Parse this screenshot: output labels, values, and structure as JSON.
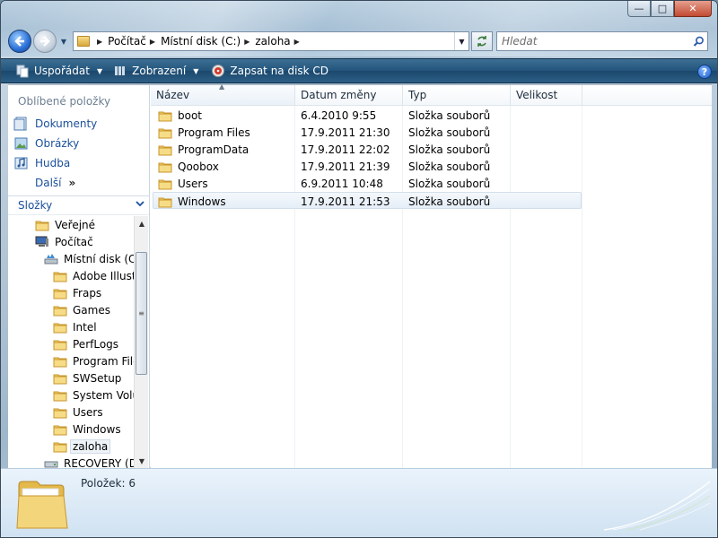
{
  "window": {
    "controls": {
      "minimize": "—",
      "maximize": "□",
      "close": "✕"
    }
  },
  "nav": {
    "back_icon": "back-arrow-icon",
    "forward_icon": "forward-arrow-icon",
    "breadcrumb": [
      "Počítač",
      "Místní disk (C:)",
      "zaloha"
    ],
    "search_placeholder": "Hledat"
  },
  "commandbar": {
    "organize": "Uspořádat",
    "views": "Zobrazení",
    "burn": "Zapsat na disk CD",
    "help": "?"
  },
  "sidebar": {
    "favorites_title": "Oblíbené položky",
    "favorites": [
      {
        "label": "Dokumenty",
        "icon": "documents-icon"
      },
      {
        "label": "Obrázky",
        "icon": "pictures-icon"
      },
      {
        "label": "Hudba",
        "icon": "music-icon"
      },
      {
        "label": "Další",
        "icon": "more-chevron-icon"
      }
    ],
    "folders_title": "Složky",
    "tree": [
      {
        "label": "Veřejné",
        "icon": "folder-icon"
      },
      {
        "label": "Počítač",
        "icon": "computer-icon"
      },
      {
        "label": "Místní disk (C:)",
        "icon": "drive-icon"
      },
      {
        "label": "Adobe Illustr",
        "icon": "folder-icon"
      },
      {
        "label": "Fraps",
        "icon": "folder-icon"
      },
      {
        "label": "Games",
        "icon": "folder-icon"
      },
      {
        "label": "Intel",
        "icon": "folder-icon"
      },
      {
        "label": "PerfLogs",
        "icon": "folder-icon"
      },
      {
        "label": "Program File",
        "icon": "folder-icon"
      },
      {
        "label": "SWSetup",
        "icon": "folder-icon"
      },
      {
        "label": "System Volu",
        "icon": "folder-icon"
      },
      {
        "label": "Users",
        "icon": "folder-icon"
      },
      {
        "label": "Windows",
        "icon": "folder-icon"
      },
      {
        "label": "zaloha",
        "icon": "folder-icon"
      },
      {
        "label": "RECOVERY (D:)",
        "icon": "drive-icon"
      }
    ]
  },
  "filelist": {
    "columns": [
      "Název",
      "Datum změny",
      "Typ",
      "Velikost"
    ],
    "rows": [
      {
        "name": "boot",
        "date": "6.4.2010 9:55",
        "type": "Složka souborů",
        "size": ""
      },
      {
        "name": "Program Files",
        "date": "17.9.2011 21:30",
        "type": "Složka souborů",
        "size": ""
      },
      {
        "name": "ProgramData",
        "date": "17.9.2011 22:02",
        "type": "Složka souborů",
        "size": ""
      },
      {
        "name": "Qoobox",
        "date": "17.9.2011 21:39",
        "type": "Složka souborů",
        "size": ""
      },
      {
        "name": "Users",
        "date": "6.9.2011 10:48",
        "type": "Složka souborů",
        "size": ""
      },
      {
        "name": "Windows",
        "date": "17.9.2011 21:53",
        "type": "Složka souborů",
        "size": ""
      }
    ]
  },
  "details": {
    "items_count": "Položek: 6"
  },
  "colors": {
    "link": "#1a4f9a",
    "commandbar": "#23557c",
    "folder": "#e8c35a"
  }
}
